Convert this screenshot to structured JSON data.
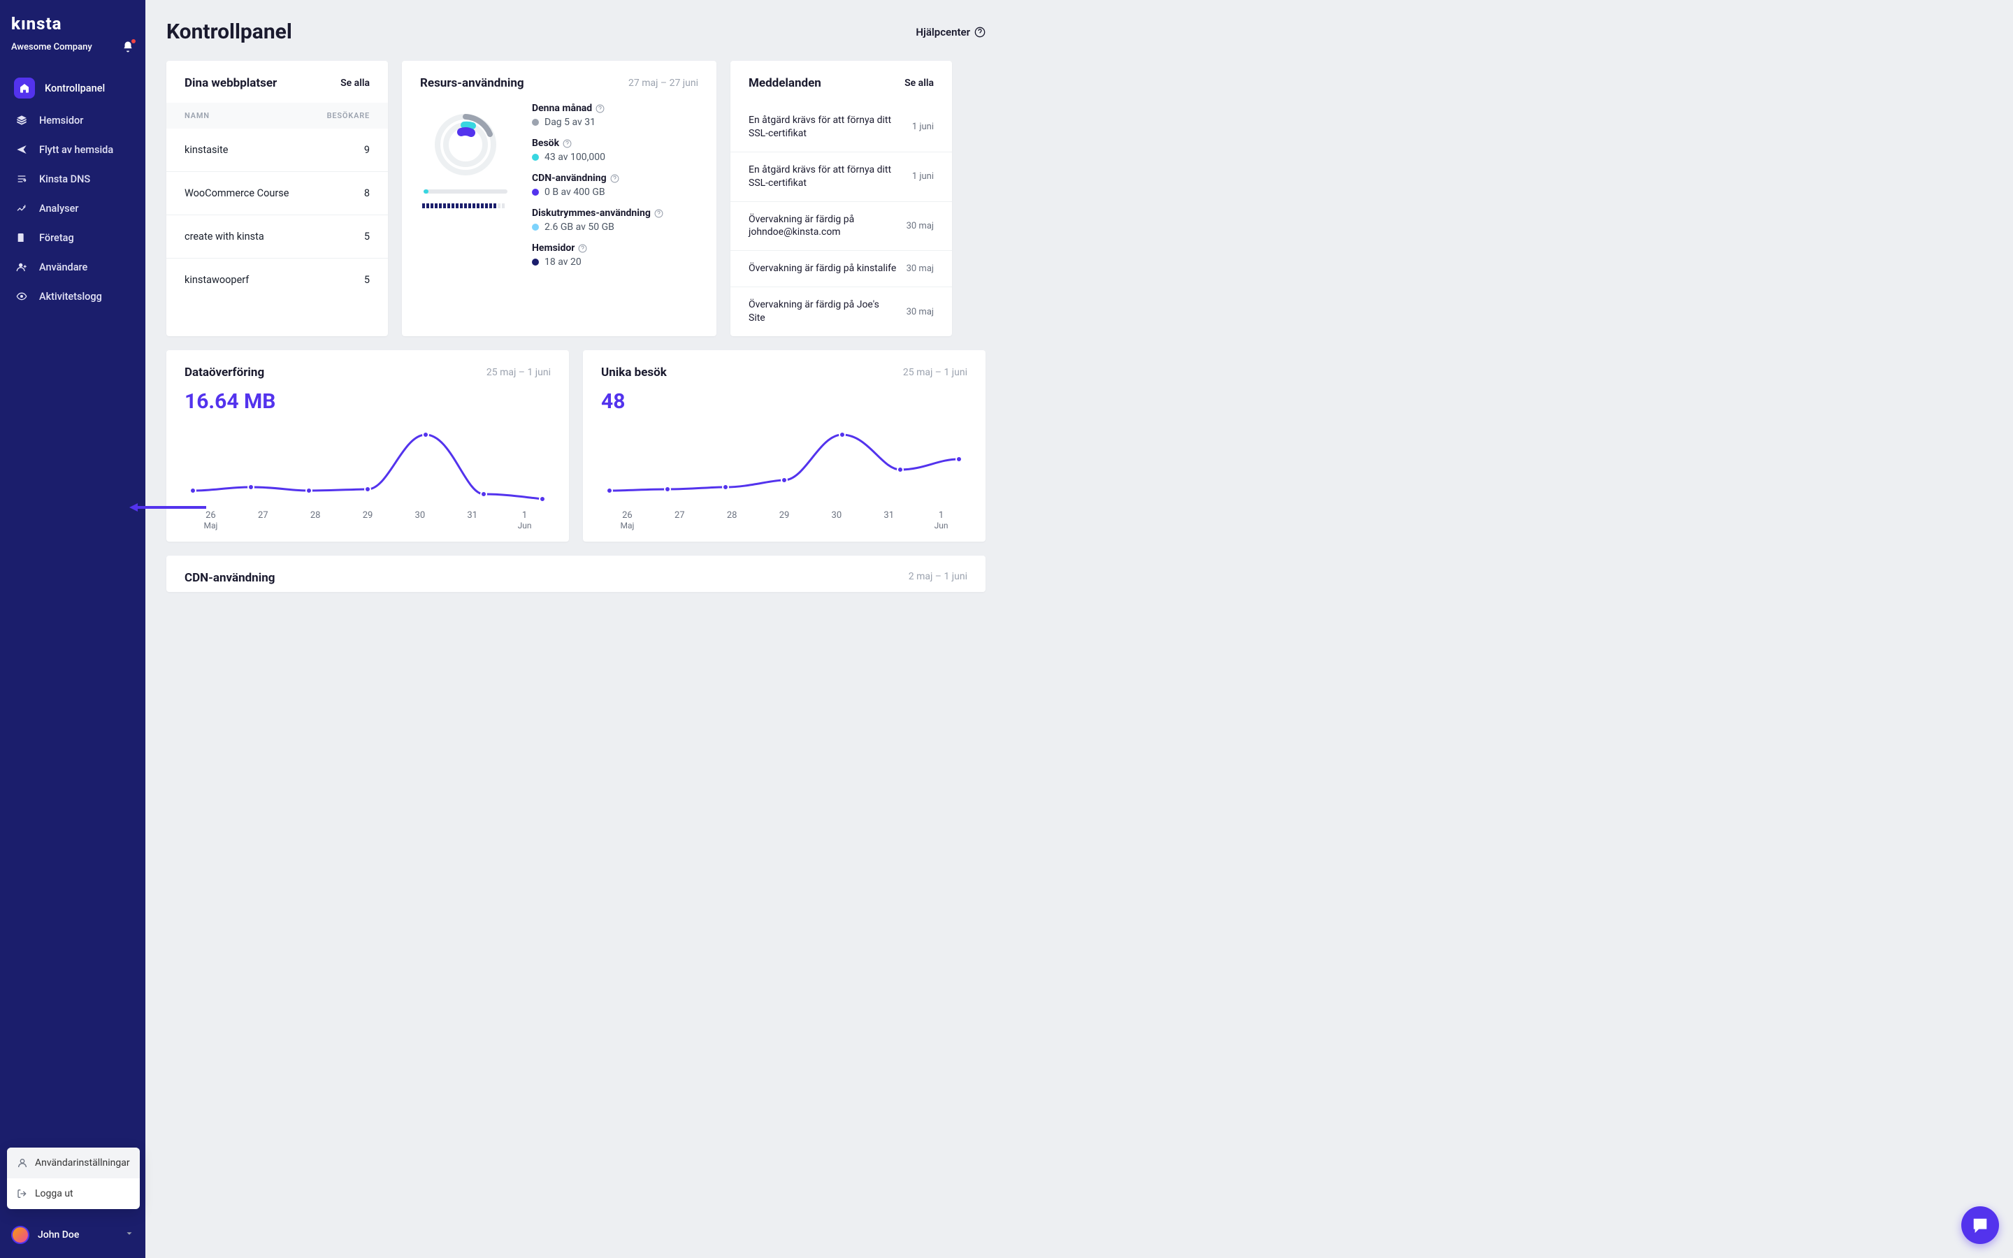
{
  "brand": "kınsta",
  "company": "Awesome Company",
  "nav": {
    "dashboard": "Kontrollpanel",
    "sites": "Hemsidor",
    "migrations": "Flytt av hemsida",
    "dns": "Kinsta DNS",
    "analytics": "Analyser",
    "company": "Företag",
    "users": "Användare",
    "activity": "Aktivitetslogg"
  },
  "user_menu": {
    "settings": "Användarinställningar",
    "logout": "Logga ut"
  },
  "user": {
    "name": "John Doe"
  },
  "header": {
    "title": "Kontrollpanel",
    "help": "Hjälpcenter"
  },
  "sites_card": {
    "title": "Dina webbplatser",
    "see_all": "Se alla",
    "col_name": "NAMN",
    "col_visitors": "BESÖKARE",
    "rows": [
      {
        "name": "kinstasite",
        "visitors": "9"
      },
      {
        "name": "WooCommerce Course",
        "visitors": "8"
      },
      {
        "name": "create with kinsta",
        "visitors": "5"
      },
      {
        "name": "kinstawooperf",
        "visitors": "5"
      }
    ]
  },
  "resource_card": {
    "title": "Resurs-användning",
    "range": "27 maj – 27 juni",
    "month_label": "Denna månad",
    "month_value": "Dag 5 av 31",
    "visits_label": "Besök",
    "visits_value": "43 av 100,000",
    "cdn_label": "CDN-användning",
    "cdn_value": "0 B av 400 GB",
    "disk_label": "Diskutrymmes-användning",
    "disk_value": "2.6 GB av 50 GB",
    "sites_label": "Hemsidor",
    "sites_value": "18 av 20"
  },
  "notif_card": {
    "title": "Meddelanden",
    "see_all": "Se alla",
    "items": [
      {
        "text": "En åtgärd krävs för att förnya ditt SSL-certifikat",
        "date": "1 juni"
      },
      {
        "text": "En åtgärd krävs för att förnya ditt SSL-certifikat",
        "date": "1 juni"
      },
      {
        "text": "Övervakning är färdig på johndoe@kinsta.com",
        "date": "30 maj"
      },
      {
        "text": "Övervakning är färdig på kinstalife",
        "date": "30 maj"
      },
      {
        "text": "Övervakning är färdig på Joe's Site",
        "date": "30 maj"
      }
    ]
  },
  "chart_data": [
    {
      "type": "line",
      "title": "Dataöverföring",
      "range": "25 maj – 1 juni",
      "display_value": "16.64 MB",
      "categories": [
        "26",
        "27",
        "28",
        "29",
        "30",
        "31",
        "1"
      ],
      "sub_labels": {
        "0": "Maj",
        "6": "Jun"
      },
      "values": [
        3,
        4,
        3,
        4,
        16,
        2,
        1
      ],
      "ylim": [
        0,
        18
      ]
    },
    {
      "type": "line",
      "title": "Unika besök",
      "range": "25 maj – 1 juni",
      "display_value": "48",
      "categories": [
        "26",
        "27",
        "28",
        "29",
        "30",
        "31",
        "1"
      ],
      "sub_labels": {
        "0": "Maj",
        "6": "Jun"
      },
      "values": [
        5,
        6,
        7,
        10,
        30,
        15,
        20
      ],
      "ylim": [
        0,
        35
      ]
    }
  ],
  "cdn_card": {
    "title": "CDN-användning",
    "range": "2 maj – 1 juni"
  },
  "colors": {
    "accent": "#5333ed",
    "navy": "#1b1e6c",
    "teal": "#38d6e0"
  }
}
